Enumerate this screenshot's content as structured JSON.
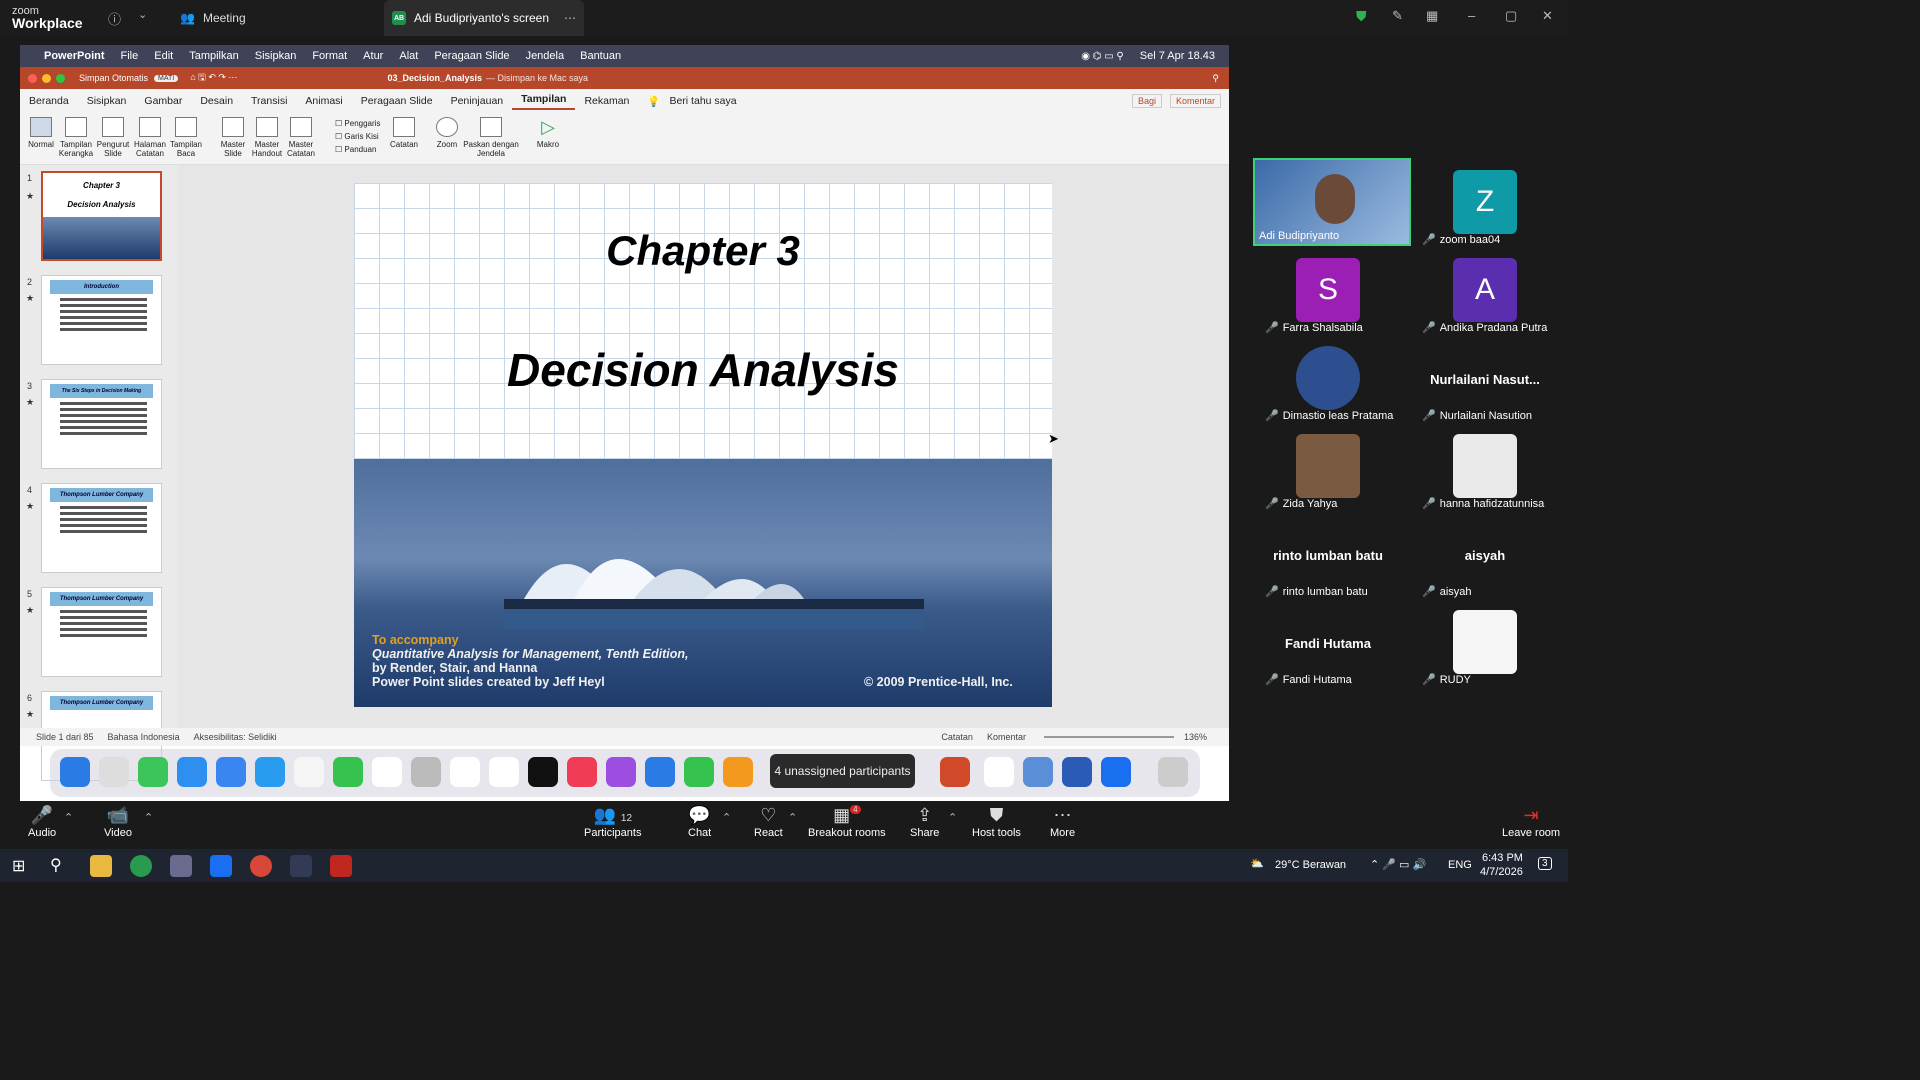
{
  "zoom": {
    "brand_line1": "zoom",
    "brand_line2": "Workplace",
    "meeting_tab": "Meeting",
    "screen_tab": "Adi Budipriyanto's screen",
    "screen_badge": "AB"
  },
  "mac_menu": {
    "app": "PowerPoint",
    "items": [
      "File",
      "Edit",
      "Tampilkan",
      "Sisipkan",
      "Format",
      "Atur",
      "Alat",
      "Peragaan Slide",
      "Jendela",
      "Bantuan"
    ],
    "clock": "Sel 7 Apr  18.43"
  },
  "ppt": {
    "autosave": "Simpan Otomatis",
    "autosave_state": "MATI",
    "doc_title": "03_Decision_Analysis",
    "doc_status": "— Disimpan ke Mac saya",
    "tabs": [
      "Beranda",
      "Sisipkan",
      "Gambar",
      "Desain",
      "Transisi",
      "Animasi",
      "Peragaan Slide",
      "Peninjauan",
      "Tampilan",
      "Rekaman"
    ],
    "active_tab": "Tampilan",
    "tell": "Beri tahu saya",
    "share": "Bagi",
    "comment": "Komentar",
    "ribbon": [
      [
        "Normal",
        ""
      ],
      [
        "Tampilan",
        "Kerangka"
      ],
      [
        "Pengurut",
        "Slide"
      ],
      [
        "Halaman",
        "Catatan"
      ],
      [
        "Tampilan",
        "Baca"
      ],
      [
        "Master",
        "Slide"
      ],
      [
        "Master",
        "Handout"
      ],
      [
        "Master",
        "Catatan"
      ]
    ],
    "checks": [
      "Penggaris",
      "Garis Kisi",
      "Panduan"
    ],
    "notes": "Catatan",
    "zoom": "Zoom",
    "fit": [
      "Paskan dengan",
      "Jendela"
    ],
    "macro": "Makro",
    "thumbs": [
      {
        "n": "1",
        "t": "Chapter 3"
      },
      {
        "n": "2",
        "t": "Introduction"
      },
      {
        "n": "3",
        "t": "The Six Steps in Decision Making"
      },
      {
        "n": "4",
        "t": "Thompson Lumber Company"
      },
      {
        "n": "5",
        "t": "Thompson Lumber Company"
      },
      {
        "n": "6",
        "t": "Thompson Lumber Company"
      }
    ],
    "thumb1_sub": "Decision Analysis",
    "status": {
      "slide": "Slide 1 dari 85",
      "lang": "Bahasa Indonesia",
      "access": "Aksesibilitas: Selidiki",
      "notes": "Catatan",
      "comments": "Komentar",
      "zoom": "136%"
    }
  },
  "slide": {
    "title1": "Chapter 3",
    "title2": "Decision Analysis",
    "acc": "To accompany",
    "line2": "Quantitative Analysis for Management, Tenth Edition,",
    "line3": "by Render, Stair, and Hanna",
    "line4": "Power Point slides created by Jeff Heyl",
    "copyright": "© 2009 Prentice-Hall, Inc."
  },
  "unassigned": "4 unassigned participants",
  "participants": [
    {
      "name": "Adi Budipriyanto",
      "letter": "",
      "color": "#5a7aa8"
    },
    {
      "name": "zoom baa04",
      "letter": "Z",
      "color": "#0e9aa7"
    },
    {
      "name": "Farra Shalsabila",
      "letter": "S",
      "color": "#9b1fb4"
    },
    {
      "name": "Andika Pradana Putra",
      "letter": "A",
      "color": "#5b2eb0"
    },
    {
      "name": "Dimastio leas Pratama",
      "letter": "",
      "color": "#2e4f8f"
    },
    {
      "name": "Nurlailani Nasution",
      "big": "Nurlailani  Nasut..."
    },
    {
      "name": "Zida Yahya",
      "letter": "",
      "color": "#7a5a40"
    },
    {
      "name": "hanna hafidzatunnisa",
      "letter": "",
      "color": "#eaeaea"
    },
    {
      "name": "rinto lumban batu",
      "big": "rinto lumban batu"
    },
    {
      "name": "aisyah",
      "big": "aisyah"
    },
    {
      "name": "Fandi Hutama",
      "big": "Fandi Hutama"
    },
    {
      "name": "RUDY",
      "letter": "",
      "color": "#f5f5f5"
    }
  ],
  "toolbar": {
    "audio": "Audio",
    "video": "Video",
    "participants": "Participants",
    "participants_count": "12",
    "chat": "Chat",
    "react": "React",
    "breakout": "Breakout rooms",
    "breakout_badge": "4",
    "share": "Share",
    "host": "Host tools",
    "more": "More",
    "leave": "Leave room"
  },
  "taskbar": {
    "weather": "29°C  Berawan",
    "lang": "ENG",
    "time": "6:43 PM",
    "date": "4/7/2026",
    "notif": "3"
  }
}
